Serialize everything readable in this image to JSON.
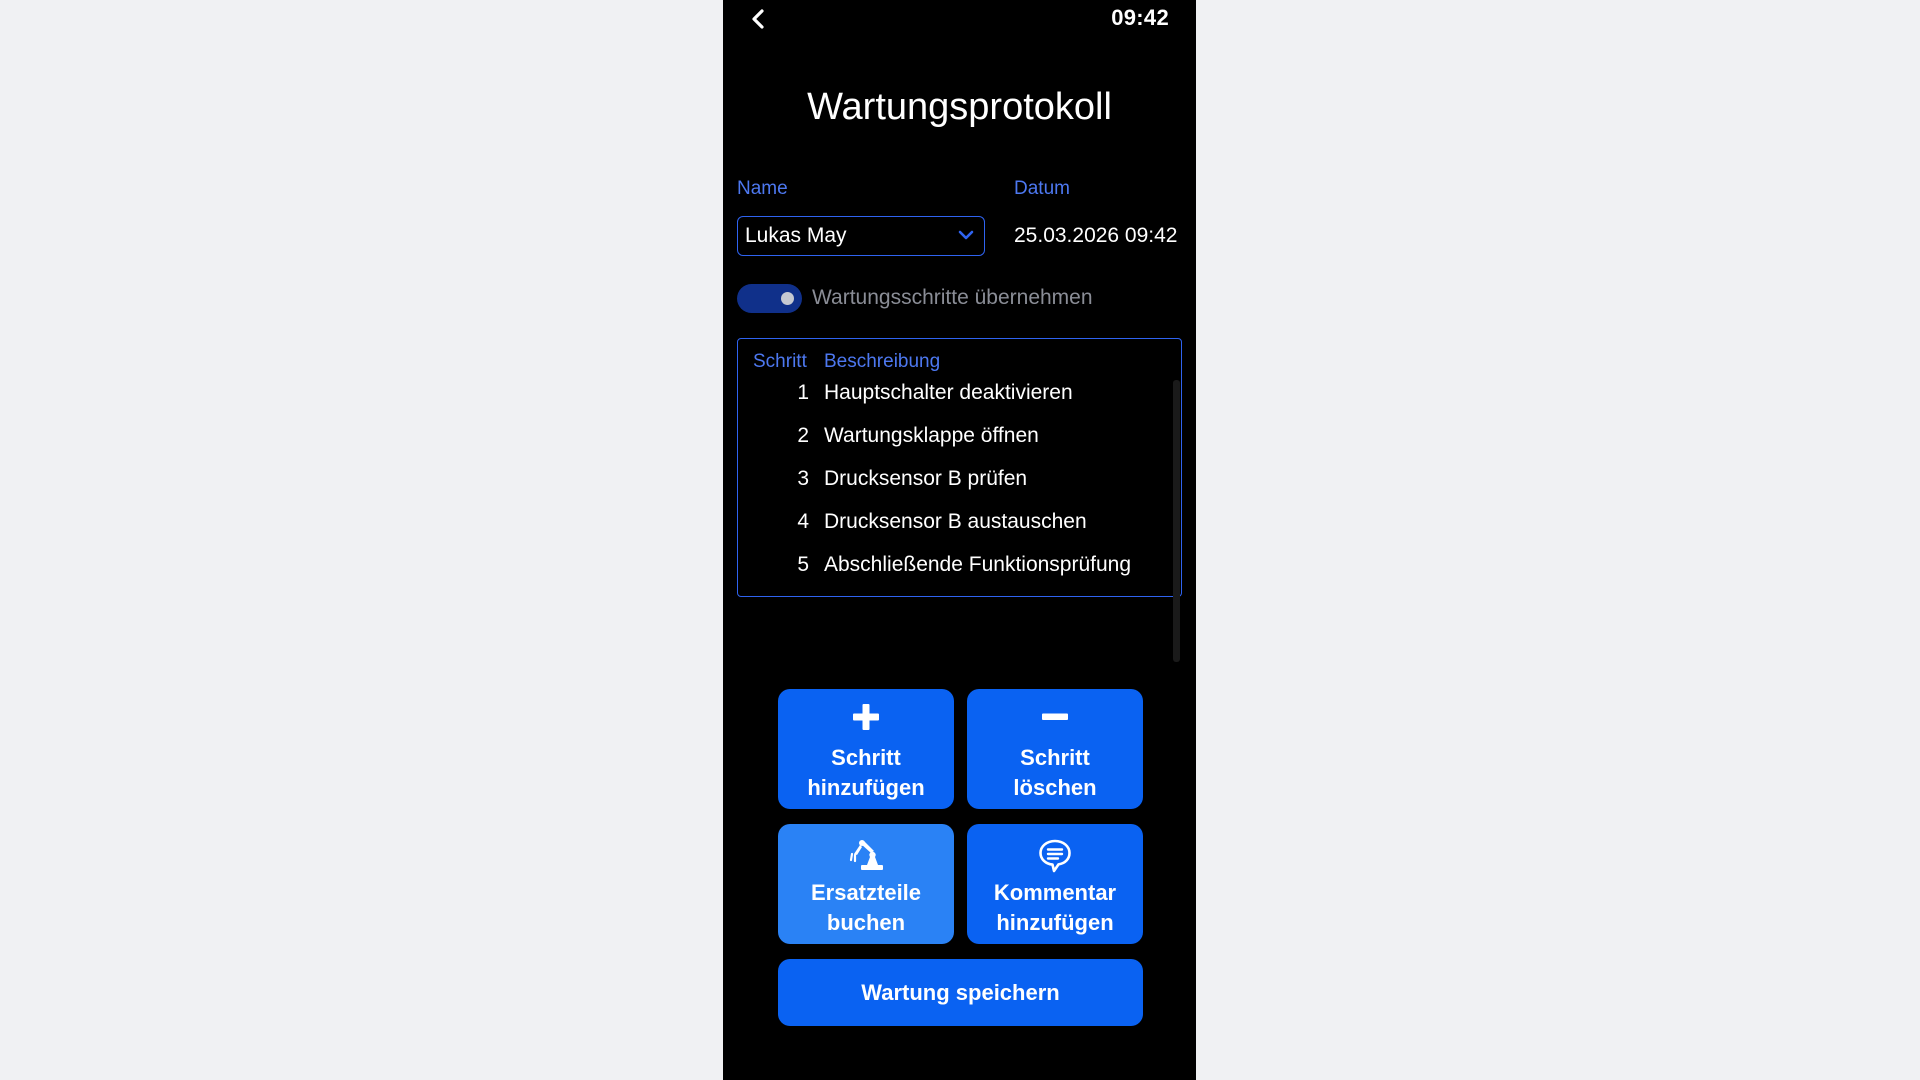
{
  "status_bar": {
    "time": "09:42",
    "back_icon": "chevron-left-icon"
  },
  "page": {
    "title": "Wartungsprotokoll"
  },
  "form": {
    "name_label": "Name",
    "name_value": "Lukas May",
    "date_label": "Datum",
    "date_value": "25.03.2026 09:42",
    "toggle_label": "Wartungsschritte übernehmen",
    "toggle_on": true
  },
  "steps_table": {
    "headers": [
      "Schritt",
      "Beschreibung"
    ],
    "rows": [
      {
        "step": "1",
        "description": "Hauptschalter deaktivieren"
      },
      {
        "step": "2",
        "description": "Wartungsklappe öffnen"
      },
      {
        "step": "3",
        "description": "Drucksensor B prüfen"
      },
      {
        "step": "4",
        "description": "Drucksensor B austauschen"
      },
      {
        "step": "5",
        "description": "Abschließende Funktionsprüfung"
      }
    ]
  },
  "actions": {
    "add_step": {
      "line1": "Schritt",
      "line2": "hinzufügen",
      "icon": "plus-icon"
    },
    "delete_step": {
      "line1": "Schritt",
      "line2": "löschen",
      "icon": "minus-icon"
    },
    "book_parts": {
      "line1": "Ersatzteile",
      "line2": "buchen",
      "icon": "robot-arm-icon"
    },
    "add_comment": {
      "line1": "Kommentar",
      "line2": "hinzufügen",
      "icon": "comment-icon"
    },
    "save": {
      "label": "Wartung speichern"
    }
  },
  "colors": {
    "background": "#000000",
    "accent": "#0a62f2",
    "accent_light": "#2a82f5",
    "label_blue": "#4d78f0",
    "toggle_track": "#10308a",
    "muted_text": "#8a8d96"
  }
}
